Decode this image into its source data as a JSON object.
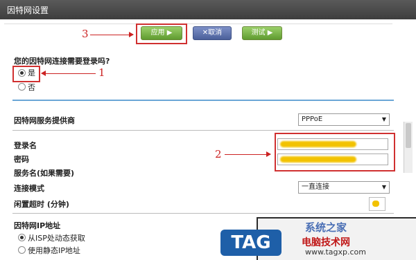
{
  "window": {
    "title": "因特网设置"
  },
  "toolbar": {
    "apply_label": "应用 ▶",
    "cancel_label": "✕取消",
    "test_label": "测试 ▶"
  },
  "annotations": {
    "one": "1",
    "two": "2",
    "three": "3"
  },
  "login_question": {
    "text": "您的因特网连接需要登录吗?",
    "options": [
      {
        "label": "是",
        "selected": true
      },
      {
        "label": "否",
        "selected": false
      }
    ]
  },
  "isp": {
    "label": "因特网服务提供商",
    "value": "PPPoE"
  },
  "fields": {
    "login_label": "登录名",
    "password_label": "密码",
    "service_label": "服务名(如果需要)",
    "connection_mode_label": "连接模式",
    "connection_mode_value": "一直连接",
    "idle_label": "闲置超时 (分钟)"
  },
  "ip_section": {
    "title": "因特网IP地址",
    "options": [
      {
        "label": "从ISP处动态获取",
        "selected": true
      },
      {
        "label": "使用静态IP地址",
        "selected": false
      }
    ]
  },
  "watermark": {
    "logo_text": "TAG",
    "title": "系统之家",
    "subtitle": "电脑技术网",
    "url": "www.tagxp.com"
  }
}
